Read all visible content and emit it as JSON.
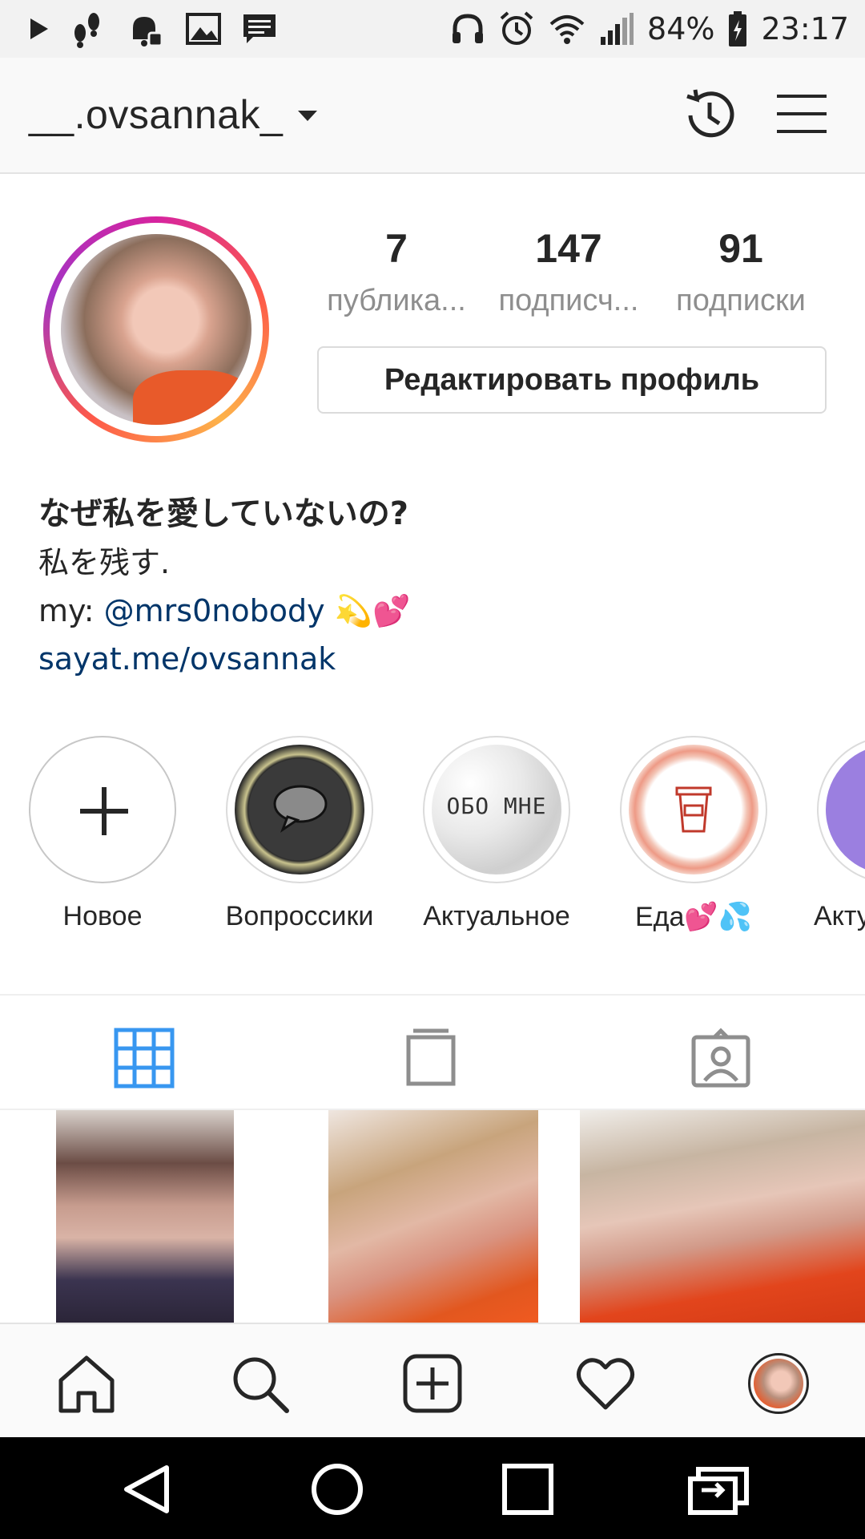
{
  "status_bar": {
    "battery": "84%",
    "time": "23:17"
  },
  "header": {
    "username": "__.ovsannak_"
  },
  "profile": {
    "stats": [
      {
        "value": "7",
        "label": "публика..."
      },
      {
        "value": "147",
        "label": "подписч..."
      },
      {
        "value": "91",
        "label": "подписки"
      }
    ],
    "edit_button": "Редактировать профиль"
  },
  "bio": {
    "name": "なぜ私を愛していないの?",
    "line1": "私を残す.",
    "line2_prefix": "my: ",
    "line2_mention": "@mrs0nobody",
    "line2_emoji": " 💫💕",
    "website": "sayat.me/ovsannak"
  },
  "highlights": [
    {
      "label": "Новое",
      "icon": "plus-icon"
    },
    {
      "label": "Вопроссики",
      "icon": "speech-bubble-wreath"
    },
    {
      "label": "Актуальное",
      "cover_text": "ОБО МНЕ"
    },
    {
      "label": "Еда💕💦",
      "icon": "coffee-cup-wreath"
    },
    {
      "label": "Акту"
    }
  ],
  "tabs": [
    {
      "name": "grid-icon",
      "active": true
    },
    {
      "name": "feed-icon",
      "active": false
    },
    {
      "name": "tagged-icon",
      "active": false
    }
  ],
  "bottom_nav": [
    "home-icon",
    "search-icon",
    "add-post-icon",
    "heart-icon",
    "profile-avatar"
  ],
  "colors": {
    "active_tab": "#3897f0",
    "link": "#003569",
    "secondary_text": "#8e8e8e",
    "notification_dot": "#ed4956"
  }
}
